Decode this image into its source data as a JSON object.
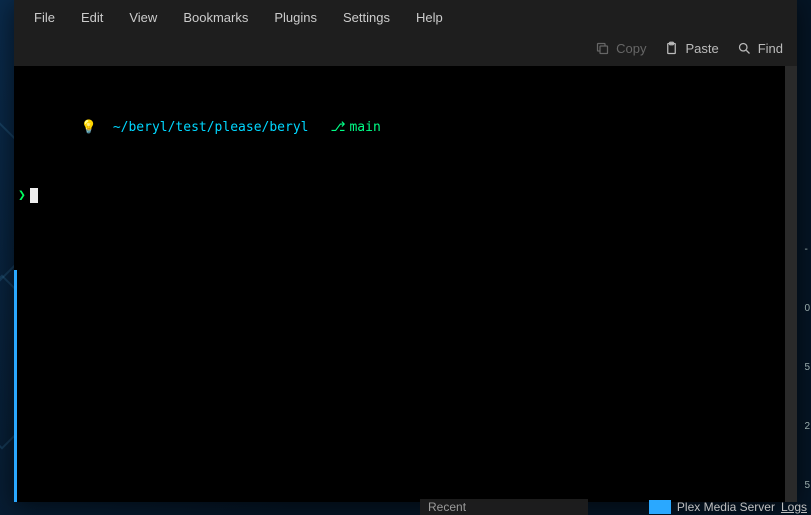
{
  "menubar": {
    "file": "File",
    "edit": "Edit",
    "view": "View",
    "bookmarks": "Bookmarks",
    "plugins": "Plugins",
    "settings": "Settings",
    "help": "Help"
  },
  "toolbar": {
    "copy": "Copy",
    "paste": "Paste",
    "find": "Find"
  },
  "prompt": {
    "bulb": "💡",
    "path": "~/beryl/test/please/beryl",
    "branch_glyph": "⎇",
    "branch": "main",
    "arrow": "❯"
  },
  "taskbar": {
    "recent": "Recent",
    "plex": "Plex Media Server",
    "logs": "Logs"
  },
  "side": {
    "a": "-",
    "b": "0",
    "c": "5",
    "d": "2",
    "e": "5"
  }
}
